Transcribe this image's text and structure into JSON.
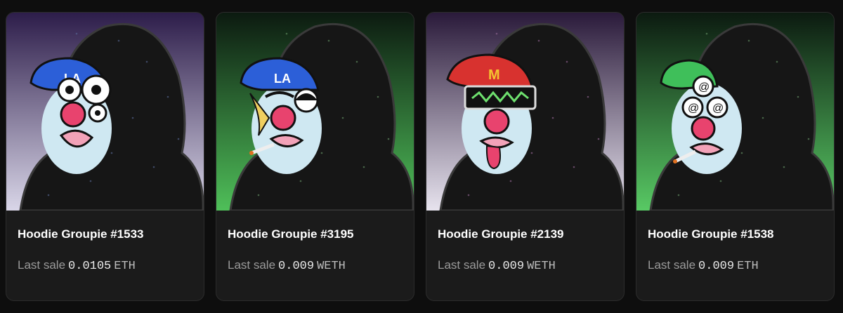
{
  "sale_prefix": "Last sale",
  "cards": [
    {
      "name": "Hoodie Groupie #1533",
      "price": "0.0105",
      "currency": "ETH",
      "bg": [
        "#2d1d4a",
        "#d9d6e8"
      ],
      "cap": "#2c5fd8",
      "cap_logo": "LA",
      "eyes": "triple",
      "extra": "none"
    },
    {
      "name": "Hoodie Groupie #3195",
      "price": "0.009",
      "currency": "WETH",
      "bg": [
        "#0c1a10",
        "#4fbf59"
      ],
      "cap": "#2c5fd8",
      "cap_logo": "LA",
      "eyes": "sleepy",
      "extra": "cigarette"
    },
    {
      "name": "Hoodie Groupie #2139",
      "price": "0.009",
      "currency": "WETH",
      "bg": [
        "#2a1a3a",
        "#e7e3ee"
      ],
      "cap": "#d8322f",
      "cap_logo": "M",
      "eyes": "visor",
      "extra": "tongue"
    },
    {
      "name": "Hoodie Groupie #1538",
      "price": "0.009",
      "currency": "ETH",
      "bg": [
        "#0c1a10",
        "#58c964"
      ],
      "cap": "#3fbf5a",
      "cap_logo": "",
      "eyes": "spiral",
      "extra": "cigarette"
    }
  ]
}
